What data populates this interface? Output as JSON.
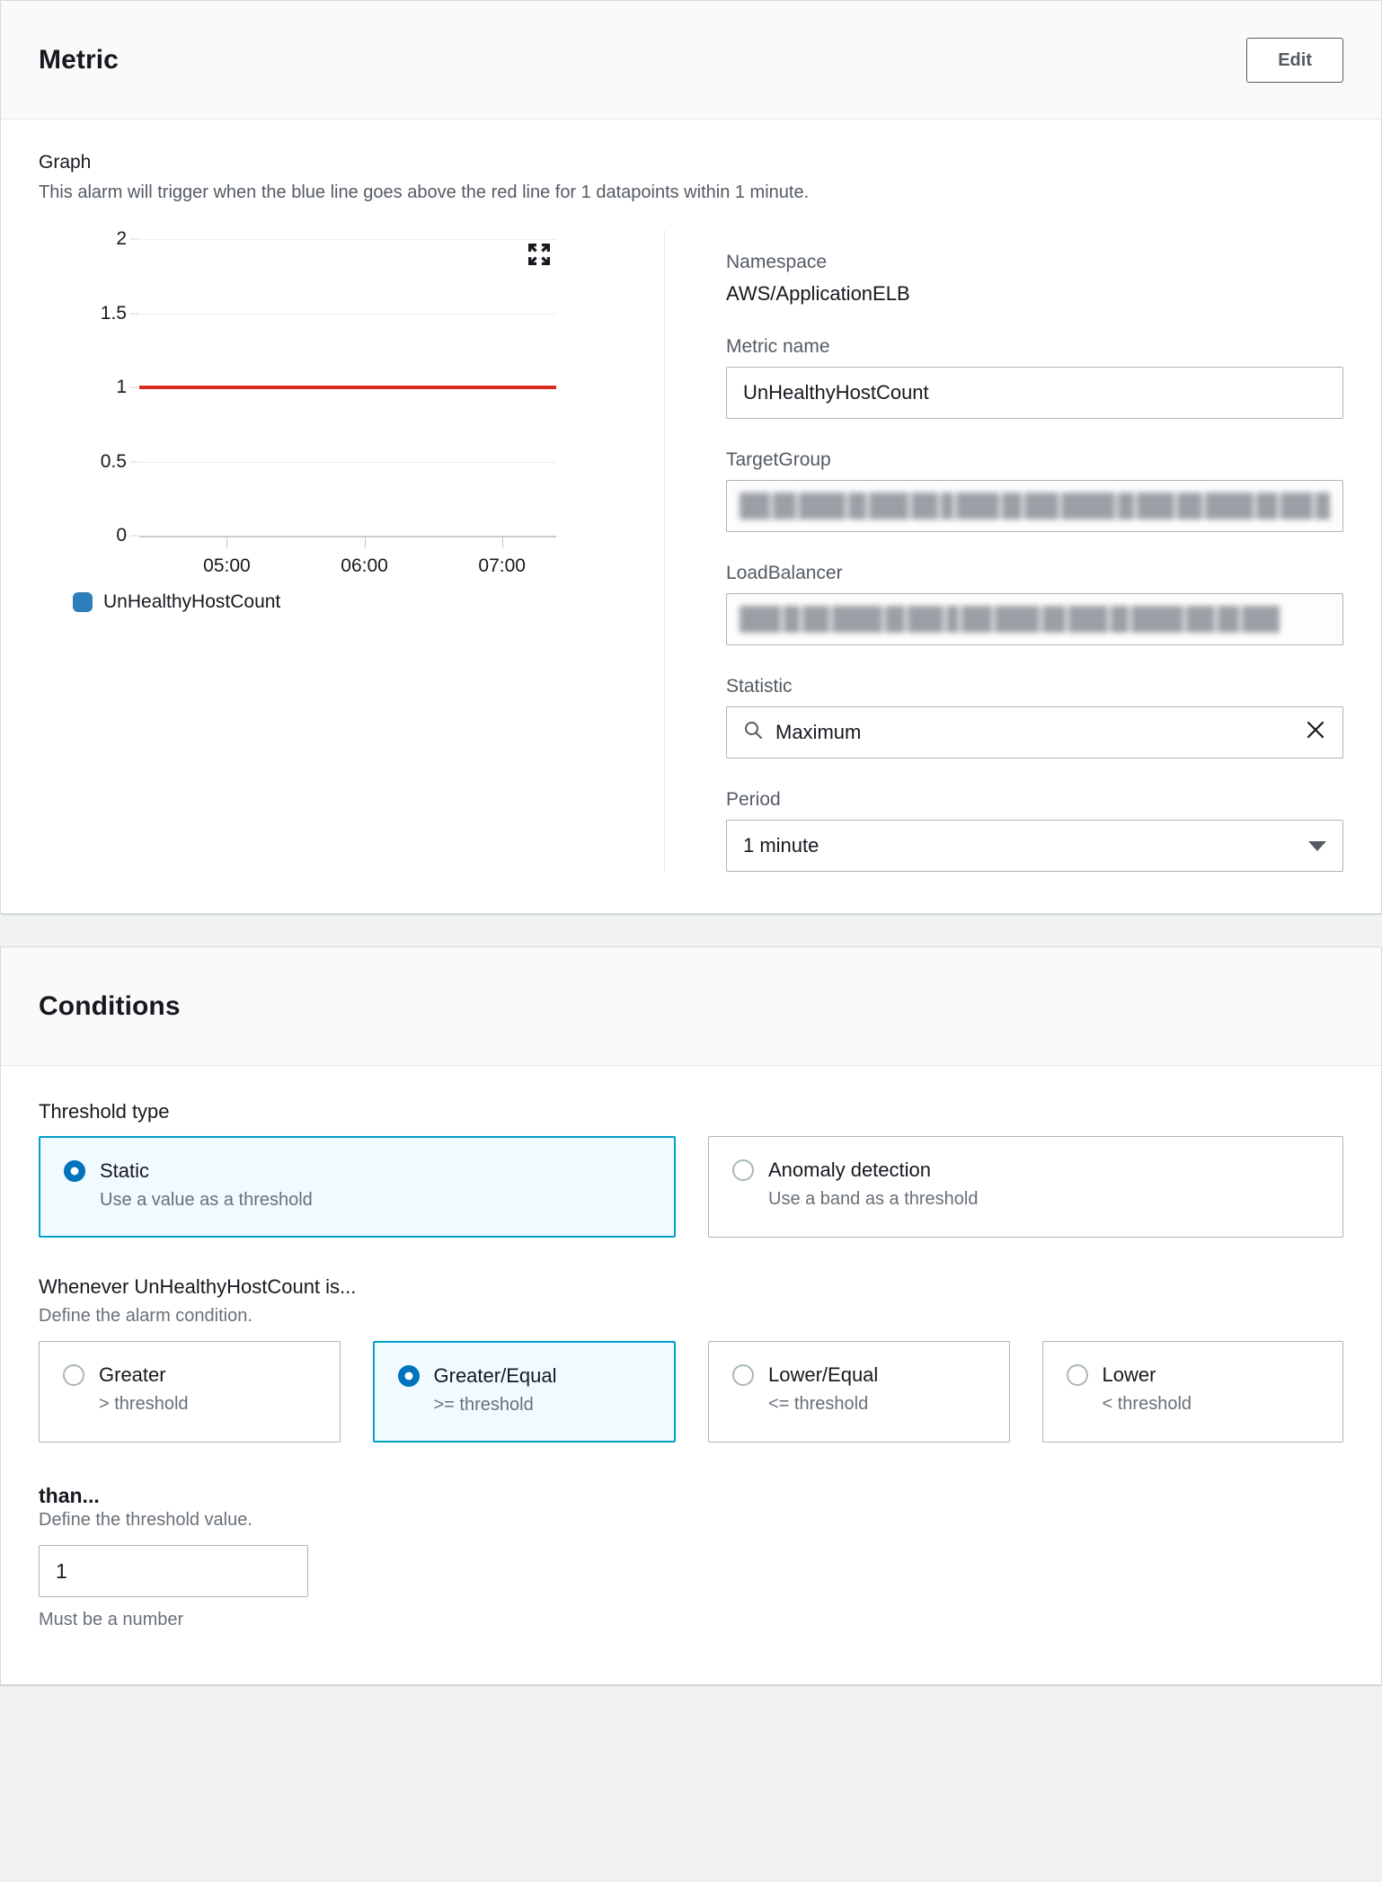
{
  "metric_panel": {
    "title": "Metric",
    "edit_label": "Edit",
    "graph_label": "Graph",
    "graph_description": "This alarm will trigger when the blue line goes above the red line for 1 datapoints within 1 minute.",
    "expand_icon": "expand-arrows-icon",
    "fields": {
      "namespace_label": "Namespace",
      "namespace_value": "AWS/ApplicationELB",
      "metric_name_label": "Metric name",
      "metric_name_value": "UnHealthyHostCount",
      "target_group_label": "TargetGroup",
      "target_group_value": "",
      "load_balancer_label": "LoadBalancer",
      "load_balancer_value": "",
      "statistic_label": "Statistic",
      "statistic_value": "Maximum",
      "statistic_search_icon": "search-icon",
      "statistic_clear_icon": "close-icon",
      "period_label": "Period",
      "period_value": "1 minute",
      "period_caret_icon": "chevron-down-icon"
    }
  },
  "chart_data": {
    "type": "line",
    "title": "",
    "xlabel": "",
    "ylabel": "",
    "ylim": [
      0,
      2
    ],
    "yticks": [
      0,
      0.5,
      1,
      1.5,
      2
    ],
    "ytick_labels": [
      "0",
      "0.5",
      "1",
      "1.5",
      "2"
    ],
    "xticks": [
      "05:00",
      "06:00",
      "07:00"
    ],
    "grid": true,
    "legend": [
      "UnHealthyHostCount"
    ],
    "legend_position": "bottom-left",
    "series": [
      {
        "name": "UnHealthyHostCount",
        "color": "#2e7ebb",
        "x": [
          "05:00",
          "06:00",
          "07:00"
        ],
        "values": [
          0,
          0,
          0
        ]
      }
    ],
    "threshold": {
      "name": "Threshold",
      "value": 1,
      "color": "#d62c20"
    }
  },
  "conditions_panel": {
    "title": "Conditions",
    "threshold_type_label": "Threshold type",
    "threshold_type_options": [
      {
        "title": "Static",
        "desc": "Use a value as a threshold",
        "selected": true
      },
      {
        "title": "Anomaly detection",
        "desc": "Use a band as a threshold",
        "selected": false
      }
    ],
    "whenever_label": "Whenever UnHealthyHostCount is...",
    "whenever_sub": "Define the alarm condition.",
    "operator_options": [
      {
        "title": "Greater",
        "desc": "> threshold",
        "selected": false
      },
      {
        "title": "Greater/Equal",
        "desc": ">= threshold",
        "selected": true
      },
      {
        "title": "Lower/Equal",
        "desc": "<= threshold",
        "selected": false
      },
      {
        "title": "Lower",
        "desc": "< threshold",
        "selected": false
      }
    ],
    "than_label": "than...",
    "than_sub": "Define the threshold value.",
    "threshold_value": "1",
    "threshold_hint": "Must be a number"
  },
  "colors": {
    "accent_blue": "#0073bb",
    "selected_border": "#00a1c9",
    "selected_bg": "#f1faff",
    "threshold_red": "#d62c20",
    "series_blue": "#2e7ebb"
  }
}
